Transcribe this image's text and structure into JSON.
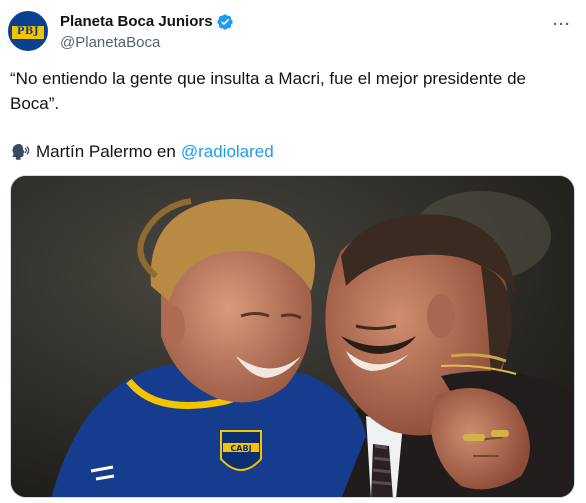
{
  "author": {
    "display_name": "Planeta Boca Juniors",
    "handle": "@PlanetaBoca",
    "avatar_text": "PBJ",
    "verified": true
  },
  "tweet": {
    "quote": "“No entiendo la gente que insulta a Macri, fue el mejor presidente de Boca”.",
    "speaker": "Martín Palermo en",
    "mention": "@radiolared"
  },
  "menu": {
    "more_label": "···"
  },
  "colors": {
    "link": "#1d9bf0",
    "verified": "#1d9bf0",
    "secondary_text": "#536471",
    "boca_blue": "#0b3f8f",
    "boca_gold": "#f5c400"
  },
  "media": {
    "crest_text": "CABJ"
  }
}
